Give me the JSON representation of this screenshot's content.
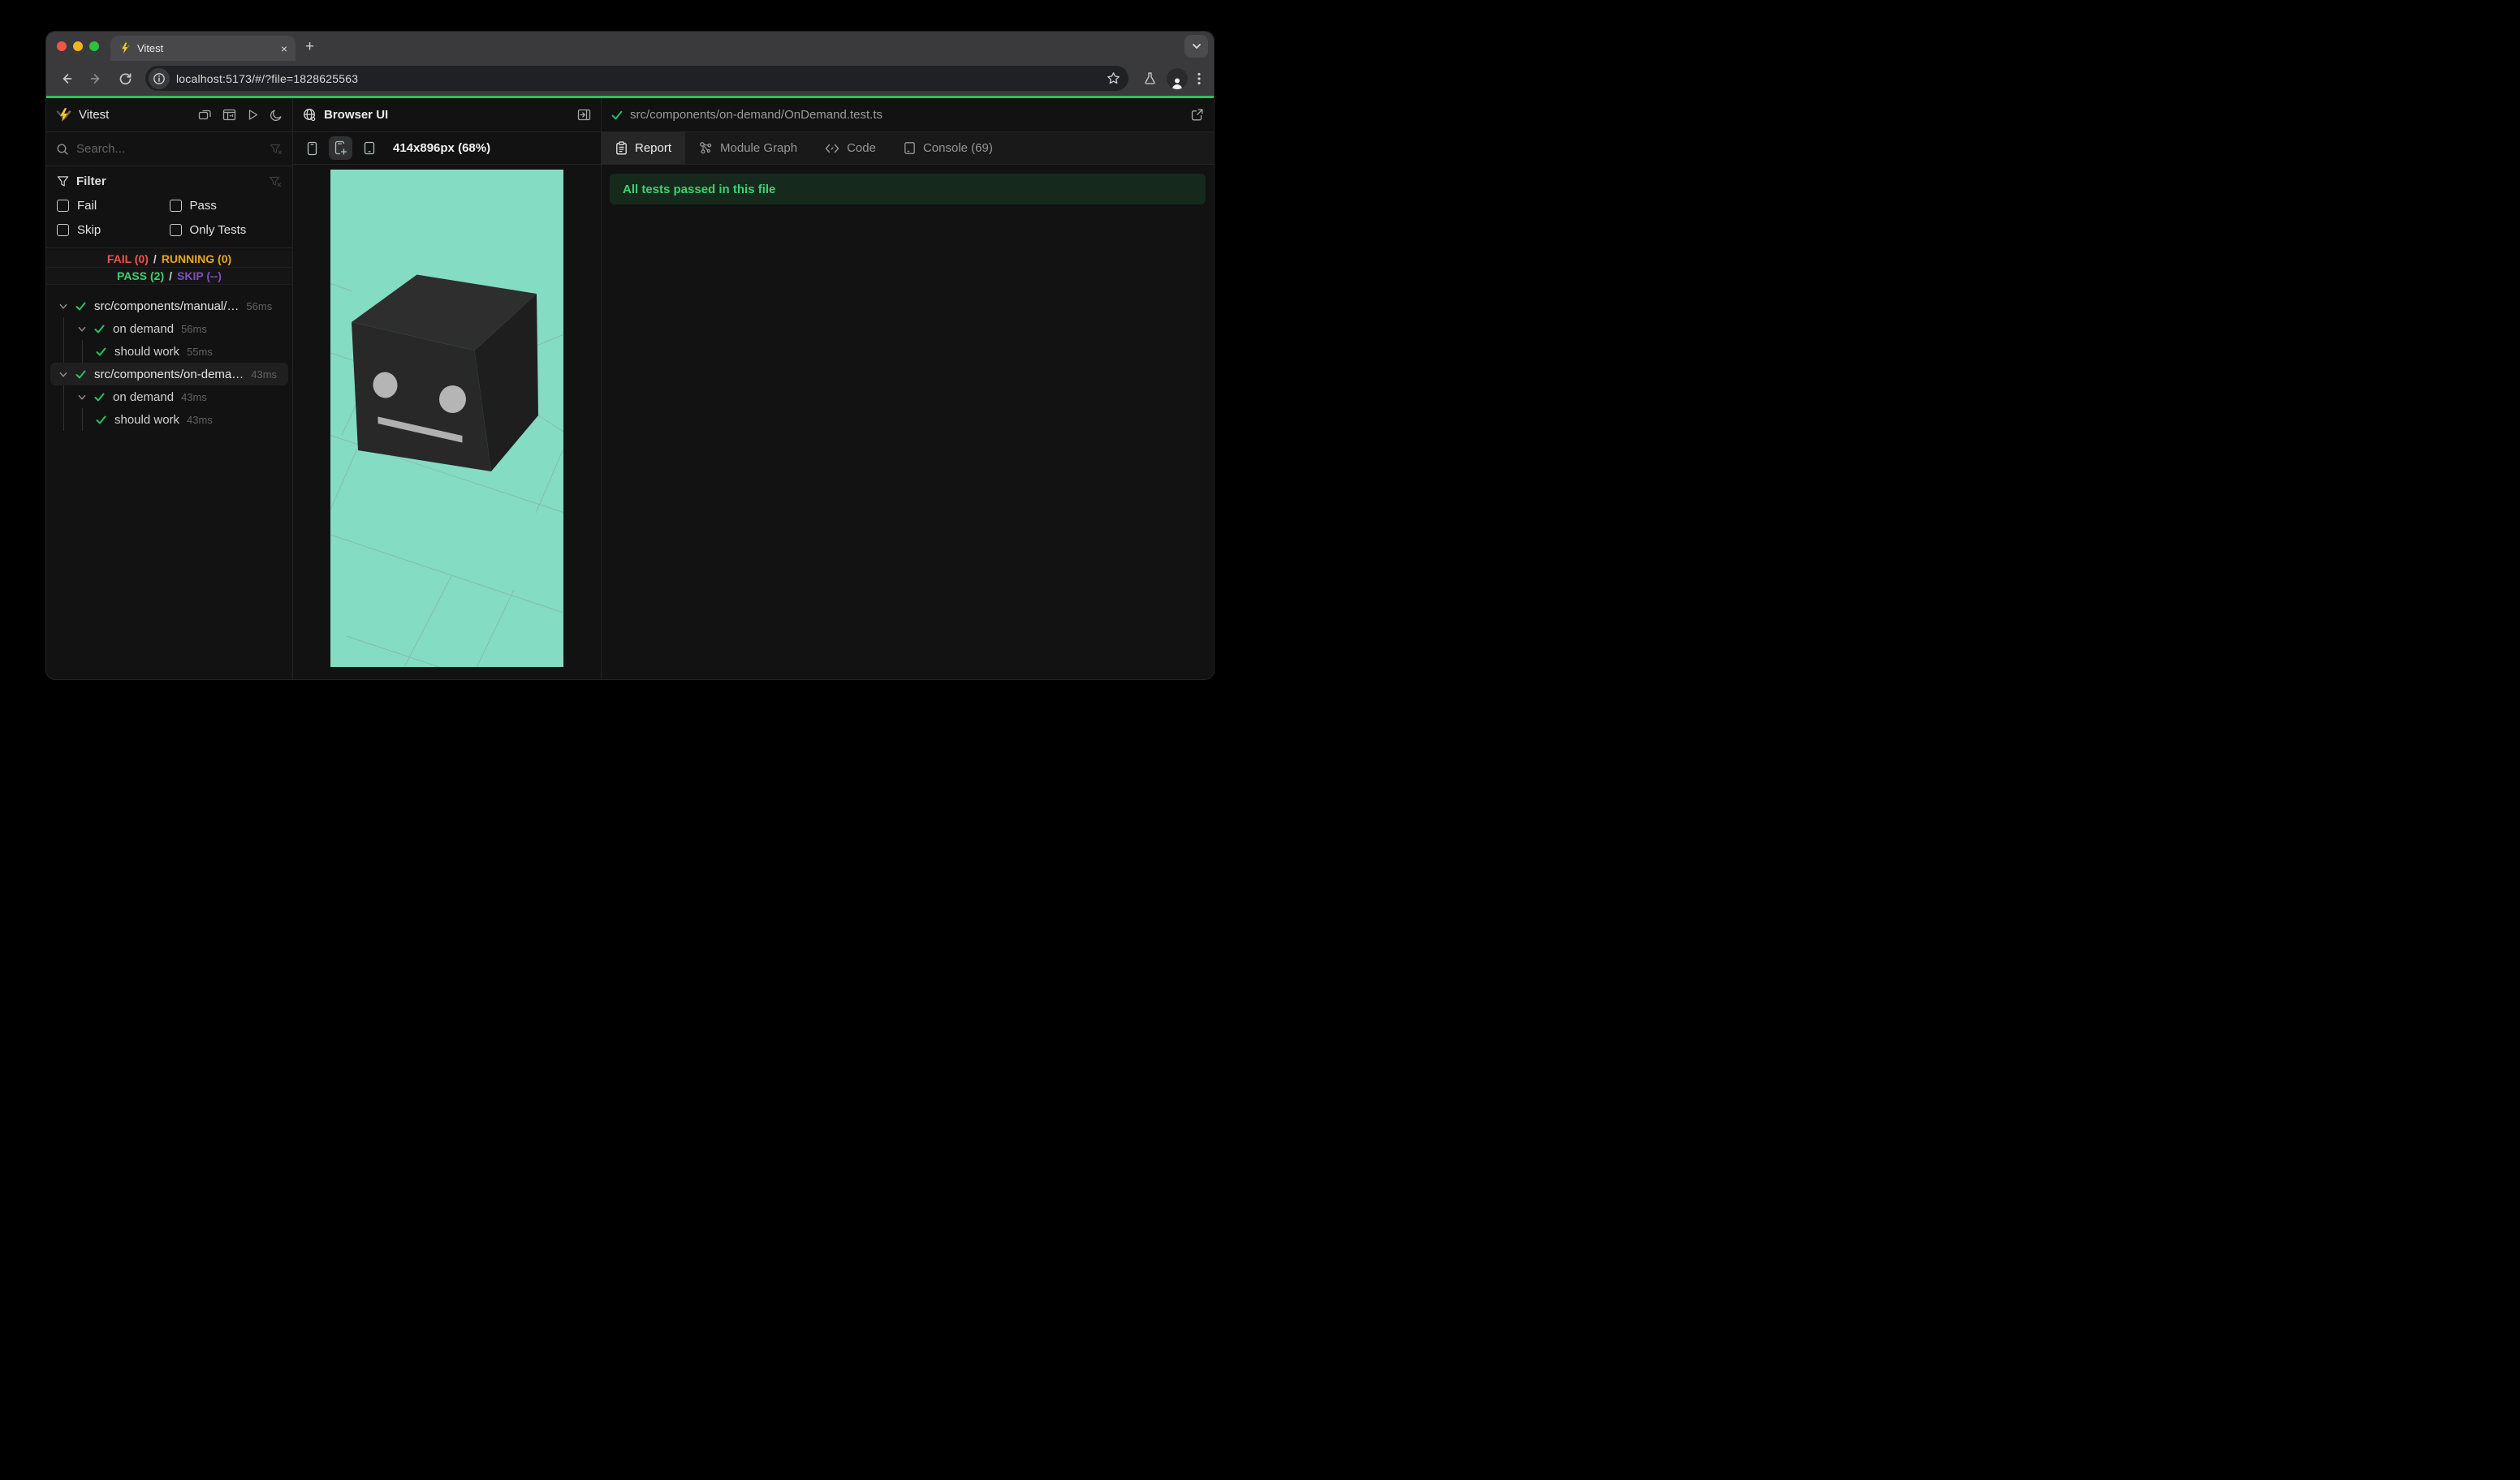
{
  "browser": {
    "tab_title": "Vitest",
    "url": "localhost:5173/#/?file=1828625563",
    "close_tab_glyph": "×",
    "new_tab_glyph": "+"
  },
  "sidebar": {
    "app_name": "Vitest",
    "search_placeholder": "Search...",
    "filter": {
      "title": "Filter",
      "options": [
        "Fail",
        "Pass",
        "Skip",
        "Only Tests"
      ]
    },
    "summary": {
      "fail": "FAIL (0)",
      "running": "RUNNING (0)",
      "pass": "PASS (2)",
      "skip": "SKIP (--)",
      "sep": "/"
    },
    "tree": [
      {
        "label": "src/components/manual/…",
        "duration": "56ms",
        "level": 0
      },
      {
        "label": "on demand",
        "duration": "56ms",
        "level": 1
      },
      {
        "label": "should work",
        "duration": "55ms",
        "level": 2
      },
      {
        "label": "src/components/on-dema…",
        "duration": "43ms",
        "level": 0,
        "selected": true
      },
      {
        "label": "on demand",
        "duration": "43ms",
        "level": 1
      },
      {
        "label": "should work",
        "duration": "43ms",
        "level": 2
      }
    ]
  },
  "browser_panel": {
    "title": "Browser UI",
    "viewport_label": "414x896px (68%)"
  },
  "report_panel": {
    "file_path": "src/components/on-demand/OnDemand.test.ts",
    "tabs": [
      {
        "label": "Report",
        "active": true
      },
      {
        "label": "Module Graph",
        "active": false
      },
      {
        "label": "Code",
        "active": false
      },
      {
        "label": "Console (69)",
        "active": false
      }
    ],
    "banner": "All tests passed in this file"
  },
  "colors": {
    "accent_green": "#24c55d",
    "fail_red": "#ef5350",
    "running_amber": "#e6a817",
    "pass_green": "#3ecf6e",
    "skip_purple": "#7e4fc0",
    "viewport_teal": "#84dcc2",
    "banner_bg": "#152a1d",
    "vitest_yellow": "#fcc72b"
  }
}
